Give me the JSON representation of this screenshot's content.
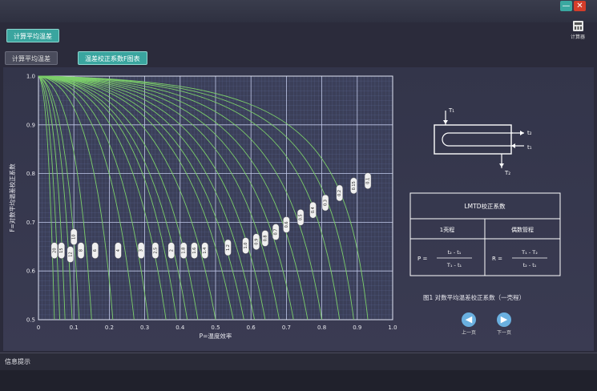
{
  "window": {
    "minimize_label": "—",
    "close_label": "✕"
  },
  "toolbar": {
    "calc_label": "计算器",
    "calc_icon": "calculator-icon"
  },
  "header": {
    "main_button": "计算平均温差"
  },
  "tabs": [
    {
      "label": "计算平均温差",
      "active": false
    },
    {
      "label": "温差校正系数F图表",
      "active": true
    }
  ],
  "chart_data": {
    "type": "line",
    "title": "",
    "xlabel": "P=温度效率",
    "ylabel": "F=对数平均温差校正系数",
    "xlim": [
      0,
      1.0
    ],
    "ylim": [
      0.5,
      1.0
    ],
    "x_ticks": [
      "0",
      "0.1",
      "0.2",
      "0.3",
      "0.4",
      "0.5",
      "0.6",
      "0.7",
      "0.8",
      "0.9",
      "1.0"
    ],
    "y_ticks": [
      "0.5",
      "0.6",
      "0.7",
      "0.8",
      "0.9",
      "1.0"
    ],
    "grid": true,
    "series_note": "family of curves, one per R value",
    "r_labels": [
      {
        "r": "20",
        "x": 0.045,
        "y": 0.642
      },
      {
        "r": "15",
        "x": 0.065,
        "y": 0.642
      },
      {
        "r": "12",
        "x": 0.09,
        "y": 0.634
      },
      {
        "r": "10",
        "x": 0.1,
        "y": 0.67
      },
      {
        "r": "8",
        "x": 0.12,
        "y": 0.642
      },
      {
        "r": "6",
        "x": 0.16,
        "y": 0.642
      },
      {
        "r": "4",
        "x": 0.225,
        "y": 0.642
      },
      {
        "r": "3",
        "x": 0.29,
        "y": 0.642
      },
      {
        "r": "2.5",
        "x": 0.33,
        "y": 0.642
      },
      {
        "r": "2",
        "x": 0.375,
        "y": 0.642
      },
      {
        "r": "1.8",
        "x": 0.41,
        "y": 0.642
      },
      {
        "r": "1.6",
        "x": 0.44,
        "y": 0.642
      },
      {
        "r": "1.4",
        "x": 0.47,
        "y": 0.642
      },
      {
        "r": "1.2",
        "x": 0.535,
        "y": 0.648
      },
      {
        "r": "1.0",
        "x": 0.585,
        "y": 0.652
      },
      {
        "r": "0.9",
        "x": 0.615,
        "y": 0.66
      },
      {
        "r": "0.8",
        "x": 0.64,
        "y": 0.667
      },
      {
        "r": "0.7",
        "x": 0.67,
        "y": 0.68
      },
      {
        "r": "0.6",
        "x": 0.7,
        "y": 0.695
      },
      {
        "r": "0.5",
        "x": 0.74,
        "y": 0.71
      },
      {
        "r": "0.4",
        "x": 0.775,
        "y": 0.725
      },
      {
        "r": "0.3",
        "x": 0.81,
        "y": 0.74
      },
      {
        "r": "0.2",
        "x": 0.85,
        "y": 0.76
      },
      {
        "r": "0.15",
        "x": 0.89,
        "y": 0.775
      },
      {
        "r": "0.1",
        "x": 0.93,
        "y": 0.785
      }
    ],
    "curves": [
      {
        "x": [
          0,
          0.015,
          0.03,
          0.045
        ],
        "y": [
          1.0,
          0.99,
          0.9,
          0.5
        ]
      },
      {
        "x": [
          0,
          0.02,
          0.04,
          0.06
        ],
        "y": [
          1.0,
          0.99,
          0.9,
          0.5
        ]
      },
      {
        "x": [
          0,
          0.025,
          0.055,
          0.075
        ],
        "y": [
          1.0,
          0.99,
          0.9,
          0.5
        ]
      },
      {
        "x": [
          0,
          0.035,
          0.07,
          0.095
        ],
        "y": [
          1.0,
          0.99,
          0.9,
          0.5
        ]
      },
      {
        "x": [
          0,
          0.04,
          0.085,
          0.115
        ],
        "y": [
          1.0,
          0.99,
          0.9,
          0.5
        ]
      },
      {
        "x": [
          0,
          0.06,
          0.115,
          0.15
        ],
        "y": [
          1.0,
          0.99,
          0.9,
          0.5
        ]
      },
      {
        "x": [
          0,
          0.09,
          0.165,
          0.21
        ],
        "y": [
          1.0,
          0.99,
          0.9,
          0.5
        ]
      },
      {
        "x": [
          0,
          0.11,
          0.21,
          0.27
        ],
        "y": [
          1.0,
          0.99,
          0.9,
          0.5
        ]
      },
      {
        "x": [
          0,
          0.13,
          0.24,
          0.31
        ],
        "y": [
          1.0,
          0.99,
          0.9,
          0.5
        ]
      },
      {
        "x": [
          0,
          0.15,
          0.28,
          0.36
        ],
        "y": [
          1.0,
          0.99,
          0.9,
          0.5
        ]
      },
      {
        "x": [
          0,
          0.17,
          0.31,
          0.39
        ],
        "y": [
          1.0,
          0.99,
          0.9,
          0.5
        ]
      },
      {
        "x": [
          0,
          0.18,
          0.33,
          0.42
        ],
        "y": [
          1.0,
          0.99,
          0.9,
          0.5
        ]
      },
      {
        "x": [
          0,
          0.2,
          0.36,
          0.45
        ],
        "y": [
          1.0,
          0.99,
          0.9,
          0.5
        ]
      },
      {
        "x": [
          0,
          0.22,
          0.4,
          0.5
        ],
        "y": [
          1.0,
          0.99,
          0.9,
          0.5
        ]
      },
      {
        "x": [
          0,
          0.25,
          0.44,
          0.55
        ],
        "y": [
          1.0,
          0.99,
          0.9,
          0.5
        ]
      },
      {
        "x": [
          0,
          0.27,
          0.47,
          0.58
        ],
        "y": [
          1.0,
          0.99,
          0.9,
          0.5
        ]
      },
      {
        "x": [
          0,
          0.3,
          0.5,
          0.61
        ],
        "y": [
          1.0,
          0.99,
          0.9,
          0.5
        ]
      },
      {
        "x": [
          0,
          0.33,
          0.54,
          0.64
        ],
        "y": [
          1.0,
          0.99,
          0.9,
          0.5
        ]
      },
      {
        "x": [
          0,
          0.37,
          0.58,
          0.68
        ],
        "y": [
          1.0,
          0.99,
          0.9,
          0.5
        ]
      },
      {
        "x": [
          0,
          0.41,
          0.62,
          0.72
        ],
        "y": [
          1.0,
          0.99,
          0.9,
          0.5
        ]
      },
      {
        "x": [
          0,
          0.46,
          0.66,
          0.76
        ],
        "y": [
          1.0,
          0.99,
          0.9,
          0.5
        ]
      },
      {
        "x": [
          0,
          0.52,
          0.71,
          0.8
        ],
        "y": [
          1.0,
          0.99,
          0.9,
          0.5
        ]
      },
      {
        "x": [
          0,
          0.6,
          0.77,
          0.85
        ],
        "y": [
          1.0,
          0.99,
          0.9,
          0.5
        ]
      },
      {
        "x": [
          0,
          0.66,
          0.82,
          0.89
        ],
        "y": [
          1.0,
          0.99,
          0.9,
          0.5
        ]
      },
      {
        "x": [
          0,
          0.72,
          0.87,
          0.93
        ],
        "y": [
          1.0,
          0.99,
          0.9,
          0.5
        ]
      }
    ]
  },
  "diagram": {
    "labels": [
      "T₁",
      "t₂",
      "t₁",
      "T₂"
    ]
  },
  "lmtd_table": {
    "title": "LMTD校正系数",
    "col1_header": "1壳程",
    "col2_header": "偶数管程",
    "p_label": "P =",
    "p_num": "t₂ - t₁",
    "p_den": "T₁ - t₁",
    "r_label": "R =",
    "r_num": "T₁ - T₂",
    "r_den": "t₂ - t₁"
  },
  "caption": "图1  对数平均温差校正系数（一壳程）",
  "nav": {
    "prev_label": "上一页",
    "next_label": "下一页"
  },
  "status": {
    "label": "信息提示"
  },
  "colors": {
    "accent": "#3aa59f",
    "curve": "#7ccf6a",
    "grid": "#6a78a8",
    "close": "#d43d2a"
  }
}
